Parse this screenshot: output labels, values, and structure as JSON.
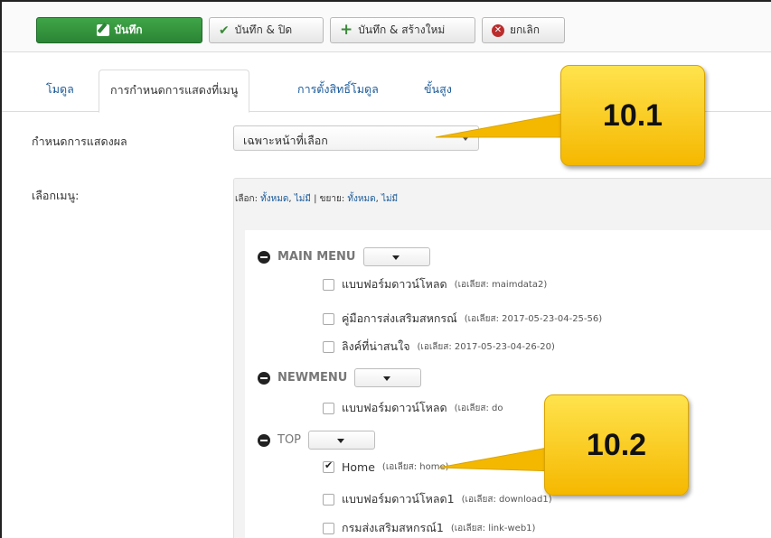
{
  "toolbar": {
    "save_label": "บันทึก",
    "save_close_label": "บันทึก & ปิด",
    "save_new_label": "บันทึก & สร้างใหม่",
    "cancel_label": "ยกเลิก"
  },
  "tabs": [
    {
      "label": "โมดูล",
      "active": false
    },
    {
      "label": "การกำหนดการแสดงที่เมนู",
      "active": true
    },
    {
      "label": "การตั้งสิทธิ์โมดูล",
      "active": false
    },
    {
      "label": "ขั้นสูง",
      "active": false
    }
  ],
  "form": {
    "assignment_label": "กำหนดการแสดงผล",
    "assignment_value": "เฉพาะหน้าที่เลือก",
    "menu_select_label": "เลือกเมนู:"
  },
  "quick_select": {
    "select_prefix": "เลือก:",
    "all": "ทั้งหมด",
    "none": "ไม่มี",
    "separator": "|",
    "expand_prefix": "ขยาย:",
    "expand_all": "ทั้งหมด",
    "expand_none": "ไม่มี",
    "comma": ","
  },
  "menus": [
    {
      "title": "MAIN MENU",
      "items": [
        {
          "label": "แบบฟอร์มดาวน์โหลด",
          "alias": "(เอเลียส: maimdata2)",
          "checked": false
        },
        {
          "label": "คู่มือการส่งเสริมสหกรณ์",
          "alias": "(เอเลียส: 2017-05-23-04-25-56)",
          "checked": false
        },
        {
          "label": "ลิงค์ที่น่าสนใจ",
          "alias": "(เอเลียส: 2017-05-23-04-26-20)",
          "checked": false
        }
      ]
    },
    {
      "title": "NEWMENU",
      "items": [
        {
          "label": "แบบฟอร์มดาวน์โหลด",
          "alias": "(เอเลียส: do",
          "checked": false
        }
      ]
    },
    {
      "title": "TOP",
      "items": [
        {
          "label": "Home",
          "alias": "(เอเลียส: home)",
          "checked": true
        },
        {
          "label": "แบบฟอร์มดาวน์โหลด1",
          "alias": "(เอเลียส: download1)",
          "checked": false
        },
        {
          "label": "กรมส่งเสริมสหกรณ์1",
          "alias": "(เอเลียส: link-web1)",
          "checked": false
        }
      ]
    }
  ],
  "callouts": {
    "first": "10.1",
    "second": "10.2"
  },
  "colors": {
    "save_button": "#2b8535",
    "link": "#1a5a99",
    "callout": "#f5c518",
    "cancel_icon": "#bb2d2d"
  }
}
